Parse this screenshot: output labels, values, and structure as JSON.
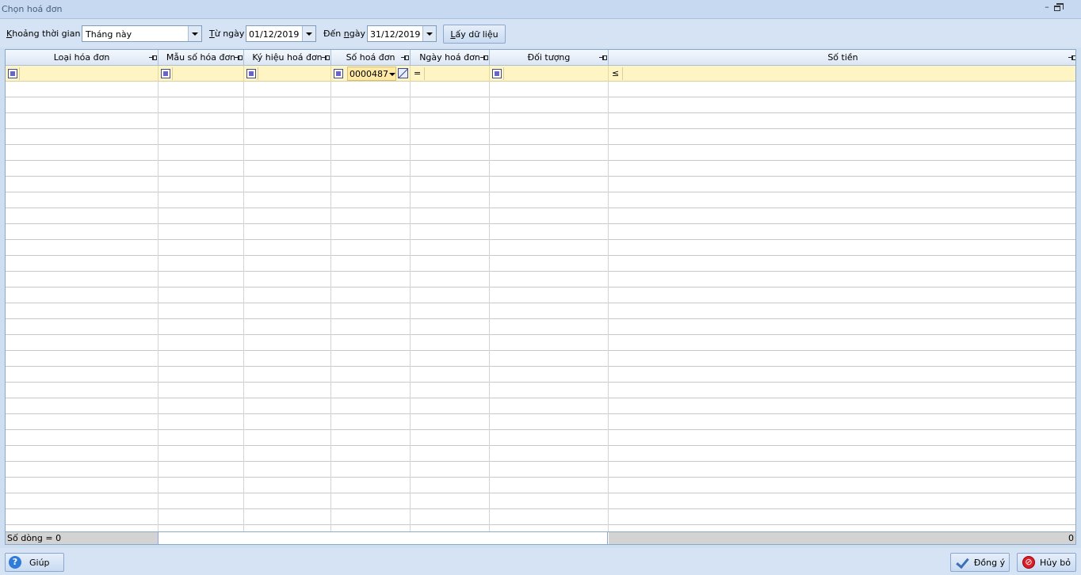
{
  "window": {
    "title": "Chọn hoá đơn",
    "minimize": "–"
  },
  "toolbar": {
    "period_label": "Khoảng thời gian",
    "period_value": "Tháng này",
    "from_label": "Từ ngày",
    "from_value": "01/12/2019",
    "to_label": "Đến ngày",
    "to_value": "31/12/2019",
    "fetch_label": "Lấy dữ liệu"
  },
  "grid": {
    "columns": [
      "Loại hóa đơn",
      "Mẫu số hóa đơn",
      "Ký hiệu hoá đơn",
      "Số hoá đơn",
      "Ngày hoá đơn",
      "Đối tượng",
      "Số tiền"
    ],
    "filters": {
      "invoice_number": "0000487",
      "date_operator": "=",
      "amount_operator": "≤"
    },
    "footer": {
      "row_count": "Số dòng = 0",
      "total_amount": "0"
    }
  },
  "buttons": {
    "help": "Giúp",
    "ok": "Đồng ý",
    "cancel": "Hủy bỏ"
  }
}
